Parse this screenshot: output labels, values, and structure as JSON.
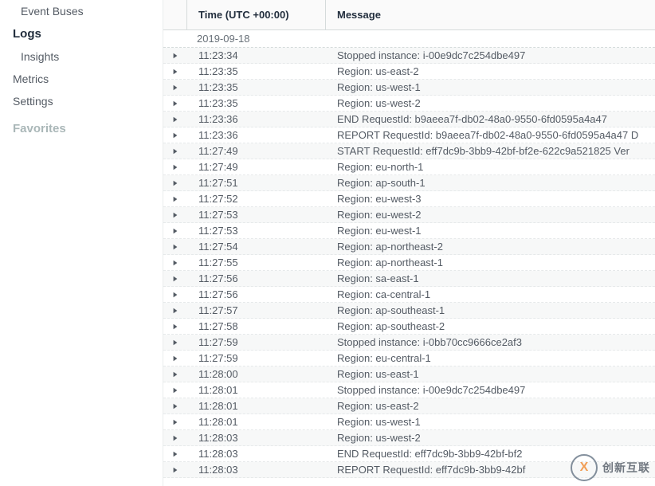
{
  "sidebar": {
    "items": [
      {
        "label": "Event Buses",
        "indent": true
      },
      {
        "label": "Logs",
        "bold": true
      },
      {
        "label": "Insights",
        "indent": true
      },
      {
        "label": "Metrics"
      },
      {
        "label": "Settings"
      },
      {
        "label": "Favorites",
        "favorites": true
      }
    ]
  },
  "table": {
    "header": {
      "time": "Time (UTC +00:00)",
      "message": "Message"
    },
    "date": "2019-09-18",
    "rows": [
      {
        "time": "11:23:34",
        "message": "Stopped instance: i-00e9dc7c254dbe497"
      },
      {
        "time": "11:23:35",
        "message": "Region: us-east-2"
      },
      {
        "time": "11:23:35",
        "message": "Region: us-west-1"
      },
      {
        "time": "11:23:35",
        "message": "Region: us-west-2"
      },
      {
        "time": "11:23:36",
        "message": "END RequestId: b9aeea7f-db02-48a0-9550-6fd0595a4a47"
      },
      {
        "time": "11:23:36",
        "message": "REPORT RequestId: b9aeea7f-db02-48a0-9550-6fd0595a4a47 D"
      },
      {
        "time": "11:27:49",
        "message": "START RequestId: eff7dc9b-3bb9-42bf-bf2e-622c9a521825 Ver"
      },
      {
        "time": "11:27:49",
        "message": "Region: eu-north-1"
      },
      {
        "time": "11:27:51",
        "message": "Region: ap-south-1"
      },
      {
        "time": "11:27:52",
        "message": "Region: eu-west-3"
      },
      {
        "time": "11:27:53",
        "message": "Region: eu-west-2"
      },
      {
        "time": "11:27:53",
        "message": "Region: eu-west-1"
      },
      {
        "time": "11:27:54",
        "message": "Region: ap-northeast-2"
      },
      {
        "time": "11:27:55",
        "message": "Region: ap-northeast-1"
      },
      {
        "time": "11:27:56",
        "message": "Region: sa-east-1"
      },
      {
        "time": "11:27:56",
        "message": "Region: ca-central-1"
      },
      {
        "time": "11:27:57",
        "message": "Region: ap-southeast-1"
      },
      {
        "time": "11:27:58",
        "message": "Region: ap-southeast-2"
      },
      {
        "time": "11:27:59",
        "message": "Stopped instance: i-0bb70cc9666ce2af3"
      },
      {
        "time": "11:27:59",
        "message": "Region: eu-central-1"
      },
      {
        "time": "11:28:00",
        "message": "Region: us-east-1"
      },
      {
        "time": "11:28:01",
        "message": "Stopped instance: i-00e9dc7c254dbe497"
      },
      {
        "time": "11:28:01",
        "message": "Region: us-east-2"
      },
      {
        "time": "11:28:01",
        "message": "Region: us-west-1"
      },
      {
        "time": "11:28:03",
        "message": "Region: us-west-2"
      },
      {
        "time": "11:28:03",
        "message": "END RequestId: eff7dc9b-3bb9-42bf-bf2"
      },
      {
        "time": "11:28:03",
        "message": "REPORT RequestId: eff7dc9b-3bb9-42bf"
      }
    ]
  },
  "watermark": {
    "text": "创新互联",
    "icon": "X"
  }
}
